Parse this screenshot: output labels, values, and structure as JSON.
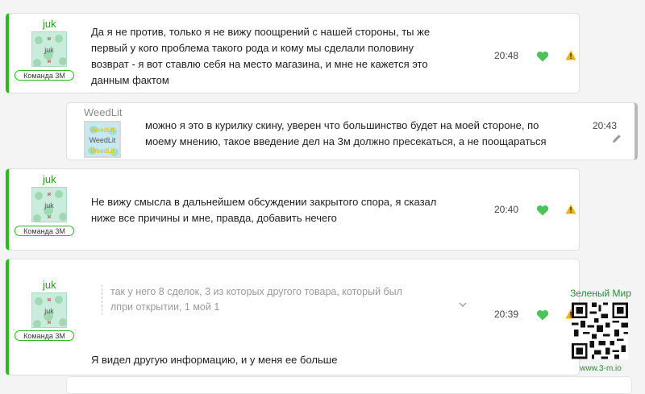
{
  "messages": [
    {
      "author": "juk",
      "badge": "Команда 3М",
      "text_lines": [
        "Да я не против, только я не вижу поощрений с нашей стороны, ты же",
        "первый у кого проблема такого рода и кому мы сделали половину",
        "возврат - я вот ставлю себя на место магазина, и мне не кажется это",
        "данным фактом"
      ],
      "time": "20:48"
    },
    {
      "author": "WeedLit",
      "avatar_text": "WeedLit",
      "text_lines": [
        "можно я это в курилку скину, уверен что большинство будет на моей стороне, по",
        "моему мнению, такое введение дел на 3м должно пресекаться, а не поощараться"
      ],
      "time": "20:43"
    },
    {
      "author": "juk",
      "badge": "Команда 3М",
      "text_lines": [
        "Не вижу смысла в дальнейшем обсуждении закрытого спора, я сказал",
        "ниже все причины и мне, правда, добавить нечего"
      ],
      "time": "20:40"
    },
    {
      "author": "juk",
      "badge": "Команда 3М",
      "quote_lines": [
        "так у него 8 сделок, 3 из которых другого товара, который был",
        "лпри открытии, 1 мой 1"
      ],
      "text_lines": [
        "Я видел другую информацию, и у меня ее больше"
      ],
      "time": "20:39"
    }
  ],
  "watermark": {
    "title": "Зеленый Мир",
    "url": "www.3-m.io"
  },
  "colors": {
    "accent": "#2bba1b",
    "heart": "#4cc35a",
    "warning": "#f0b400",
    "background": "#f4f4f4"
  },
  "icons": {
    "reaction": "heart-icon",
    "report": "warning-icon",
    "edit": "pencil-icon",
    "expand": "chevron-down-icon",
    "watermark_code": "qr-code-icon"
  }
}
